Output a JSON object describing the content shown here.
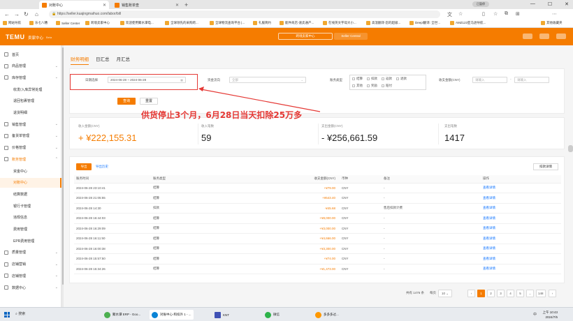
{
  "browser": {
    "tabs": [
      {
        "label": "对账中心",
        "active": true
      },
      {
        "label": "销售账单查"
      }
    ],
    "new_tab": "+",
    "profile": "已暂停",
    "url": "https://seller.kuajingmaihuo.com/labor/bill",
    "bookmarks": [
      "网站导航",
      "乐七八糟",
      "Seller Center",
      "跨境卖家中心",
      "欢迎使用聚水潭电...",
      "全球领先的采购跨...",
      "全球物流查询平台 |...",
      "礼服简约",
      "能件商店-速卖通产...",
      "在线英文字母大小...",
      "高温翻译-您的超级...",
      "Deepl翻译: 全世...",
      "AMZ123亚马逊导航...",
      "其他收藏夹"
    ]
  },
  "header": {
    "logo": "TEMU",
    "subtitle": "卖家中心",
    "tag": "Beta",
    "btn_seller": "跨境卖家中心",
    "btn_central": "Seller Central"
  },
  "sidebar": {
    "items": [
      {
        "label": "首页",
        "type": "top"
      },
      {
        "label": "商品管理",
        "type": "top"
      },
      {
        "label": "库存管理",
        "type": "top"
      },
      {
        "label": "收发/入库异常处理",
        "type": "sub"
      },
      {
        "label": "退回包裹管理",
        "type": "sub"
      },
      {
        "label": "退货明细",
        "type": "sub"
      },
      {
        "label": "销售管理",
        "type": "top"
      },
      {
        "label": "备货单管理",
        "type": "top"
      },
      {
        "label": "价格管理",
        "type": "top"
      },
      {
        "label": "账务管理",
        "type": "top",
        "open": true
      },
      {
        "label": "资金中心",
        "type": "sub"
      },
      {
        "label": "对账中心",
        "type": "sub",
        "active": true
      },
      {
        "label": "结算数据",
        "type": "sub"
      },
      {
        "label": "银行卡管理",
        "type": "sub"
      },
      {
        "label": "违规信息",
        "type": "sub"
      },
      {
        "label": "费用管理",
        "type": "sub"
      },
      {
        "label": "EPR费用管理",
        "type": "sub"
      },
      {
        "label": "质量管理",
        "type": "top"
      },
      {
        "label": "店铺营销",
        "type": "top"
      },
      {
        "label": "店铺管理",
        "type": "top"
      },
      {
        "label": "数据中心",
        "type": "top"
      }
    ]
  },
  "main": {
    "tabs": [
      "财务明细",
      "日汇总",
      "月汇总"
    ],
    "filters": {
      "date_label": "日期选择",
      "date_value": "2024-06-28  ~  2024-06-28",
      "direction_label": "资金流向",
      "direction_placeholder": "全部",
      "type_label": "账务类型",
      "types": [
        "结算",
        "扣款",
        "返款",
        "退款",
        "其他",
        "奖励",
        "赔付"
      ],
      "amount_label": "收支金额(CNY)",
      "amount_min": "请输入",
      "amount_max": "请输入",
      "search": "查询",
      "reset": "重置"
    },
    "stats": [
      {
        "label": "收入金额(CNY)",
        "value": "+ ¥222,155.31"
      },
      {
        "label": "收入笔数",
        "value": "59"
      },
      {
        "label": "支出金额(CNY)",
        "value": "- ¥256,661.59"
      },
      {
        "label": "支出笔数",
        "value": "1417"
      }
    ],
    "annotation": "供货停止3个月，6月28日当天扣除25万多",
    "table": {
      "export": "导出",
      "export_history": "导出历史",
      "detail_btn": "扣款详情",
      "columns": [
        "账务时间",
        "账务类型",
        "收支金额(CNY)",
        "币种",
        "备注",
        "操作"
      ],
      "rows": [
        [
          "2024-06-28 23:10:41",
          "结算",
          "+¥79.00",
          "CNY",
          "-",
          "查看详情"
        ],
        [
          "2024-06-28 21:05:55",
          "结算",
          "+¥543.40",
          "CNY",
          "-",
          "查看详情"
        ],
        [
          "2024-06-28 14:30",
          "扣款",
          "-¥45.68",
          "CNY",
          "售后扣款计费",
          "查看详情"
        ],
        [
          "2024-06-28 16:44:03",
          "结算",
          "+¥8,000.00",
          "CNY",
          "-",
          "查看详情"
        ],
        [
          "2024-06-28 16:29:09",
          "结算",
          "+¥3,000.00",
          "CNY",
          "-",
          "查看详情"
        ],
        [
          "2024-06-28 16:11:50",
          "结算",
          "+¥4,666.00",
          "CNY",
          "-",
          "查看详情"
        ],
        [
          "2024-06-28 16:00:38",
          "结算",
          "+¥3,300.00",
          "CNY",
          "-",
          "查看详情"
        ],
        [
          "2024-06-28 15:57:50",
          "结算",
          "+¥74.00",
          "CNY",
          "-",
          "查看详情"
        ],
        [
          "2024-06-28 15:34:26",
          "结算",
          "+¥1,473.00",
          "CNY",
          "-",
          "查看详情"
        ]
      ]
    },
    "pagination": {
      "total": "共有 1476 条",
      "per_page_label": "每页",
      "per_page": "10",
      "pages": [
        "‹",
        "1",
        "2",
        "3",
        "4",
        "5",
        "...",
        "148",
        "›"
      ],
      "current": "1"
    }
  },
  "taskbar": {
    "search": "搜索",
    "apps": [
      "聚水潭 ERP - Goo...",
      "对账中心-和扣外 1 - ...",
      "KNT",
      "微信",
      "多多多过..."
    ],
    "tray": "中",
    "time": "上午 10:43",
    "date": "2024/7/5"
  }
}
